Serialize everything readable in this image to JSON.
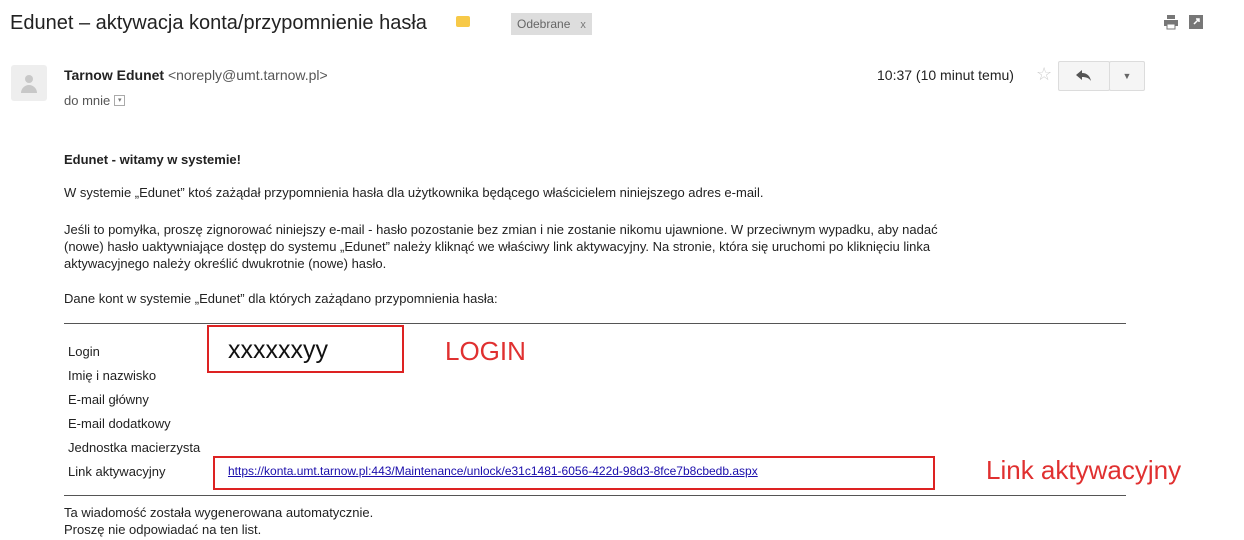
{
  "header": {
    "subject": "Edunet – aktywacja konta/przypomnienie hasła",
    "label_icon": "label-tag-icon",
    "label_color": "#f7c948",
    "inbox_chip": "Odebrane",
    "inbox_chip_remove": "x",
    "print_icon": "print-icon",
    "newwindow_icon": "new-window-icon"
  },
  "message": {
    "sender_name": "Tarnow Edunet",
    "sender_email": "<noreply@umt.tarnow.pl>",
    "recipient": "do mnie",
    "time": "10:37 (10 minut temu)",
    "star_icon": "star-icon",
    "reply_icon": "reply-icon",
    "more_icon": "more-dropdown-icon"
  },
  "body": {
    "greeting": "Edunet - witamy w systemie!",
    "p1": "W systemie „Edunet” ktoś zażądał przypomnienia hasła dla użytkownika będącego właścicielem niniejszego adres e-mail.",
    "p2_lines": [
      "Jeśli to pomyłka, proszę zignorować niniejszy e-mail - hasło pozostanie bez zmian i nie zostanie nikomu ujawnione. W przeciwnym wypadku, aby nadać",
      "(nowe) hasło uaktywniające dostęp do systemu „Edunet” należy kliknąć we właściwy link aktywacyjny. Na stronie, która się uruchomi po kliknięciu linka",
      "aktywacyjnego należy określić dwukrotnie (nowe) hasło."
    ],
    "p3": "Dane kont w systemie „Edunet” dla których zażądano przypomnienia hasła:"
  },
  "account_table": {
    "rows": [
      {
        "label": "Login",
        "value": "xxxxxxyy"
      },
      {
        "label": "Imię i nazwisko",
        "value": ""
      },
      {
        "label": "E-mail główny",
        "value": ""
      },
      {
        "label": "E-mail dodatkowy",
        "value": ""
      },
      {
        "label": "Jednostka macierzysta",
        "value": ""
      },
      {
        "label": "Link aktywacyjny",
        "value": "https://konta.umt.tarnow.pl:443/Maintenance/unlock/e31c1481-6056-422d-98d3-8fce7b8cbedb.aspx"
      }
    ]
  },
  "annotations": {
    "login": "LOGIN",
    "link": "Link aktywacyjny",
    "color": "#dd2222"
  },
  "footer": {
    "line1": "Ta wiadomość została wygenerowana automatycznie.",
    "line2": "Proszę nie odpowiadać na ten list."
  }
}
